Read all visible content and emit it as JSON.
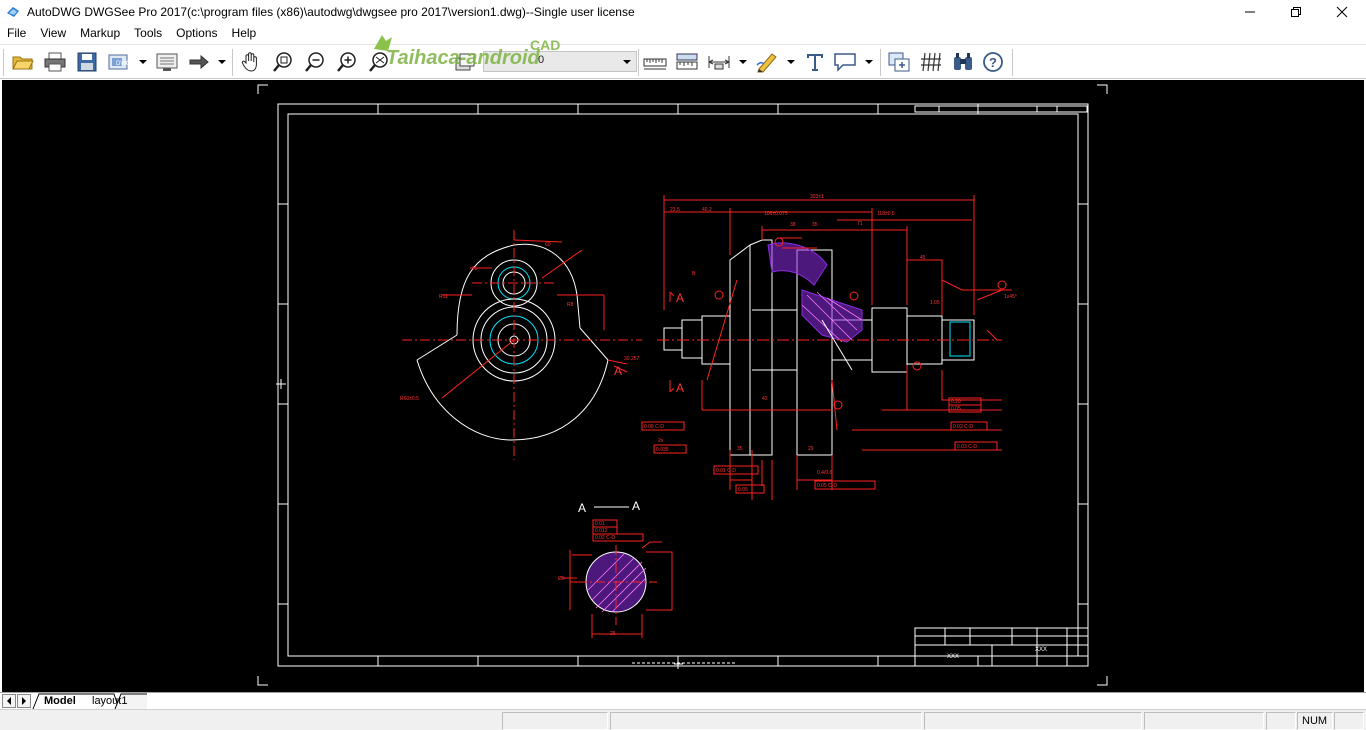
{
  "window": {
    "title": "AutoDWG DWGSee Pro 2017(c:\\program files (x86)\\autodwg\\dwgsee pro 2017\\version1.dwg)--Single user license",
    "minimize_icon": "minimize-icon",
    "maximize_icon": "restore-icon",
    "close_icon": "close-icon"
  },
  "menu": {
    "items": [
      "File",
      "View",
      "Markup",
      "Tools",
      "Options",
      "Help"
    ]
  },
  "toolbar": {
    "layer_value": "0",
    "buttons": [
      "open-folder-icon",
      "print-icon",
      "save-icon",
      "export-icon",
      "compare-icon",
      "next-arrow-icon",
      "pan-hand-icon",
      "zoom-window-icon",
      "zoom-out-icon",
      "zoom-in-icon",
      "zoom-extents-icon",
      "layer-icon",
      "measure-distance-icon",
      "measure-area-icon",
      "dimension-icon",
      "pen-icon",
      "text-icon",
      "callout-icon",
      "insert-image-icon",
      "hatch-icon",
      "binoculars-icon",
      "help-icon"
    ]
  },
  "watermark": {
    "text": "Taihaca-android",
    "suffix": "CAD"
  },
  "tabs": {
    "items": [
      "Model",
      "layout1"
    ],
    "active": "Model"
  },
  "drawing": {
    "section_label_left": "A",
    "section_label_right": "A",
    "title_block_name": "XXX",
    "title_block_name2": "XXX",
    "dimensions": [
      "303±1",
      "23.5",
      "40.2",
      "106±0.075",
      "118±0.5",
      "71",
      "38",
      "45",
      "35",
      "35",
      "29",
      "42",
      "B",
      "R35",
      "R12",
      "60",
      "25",
      "0.20",
      "0.05"
    ]
  },
  "status": {
    "num": "NUM"
  },
  "colors": {
    "canvas_bg": "#000000",
    "geometry": "#ffffff",
    "dimension": "#ff0000",
    "hatch": "#8a2be2"
  }
}
